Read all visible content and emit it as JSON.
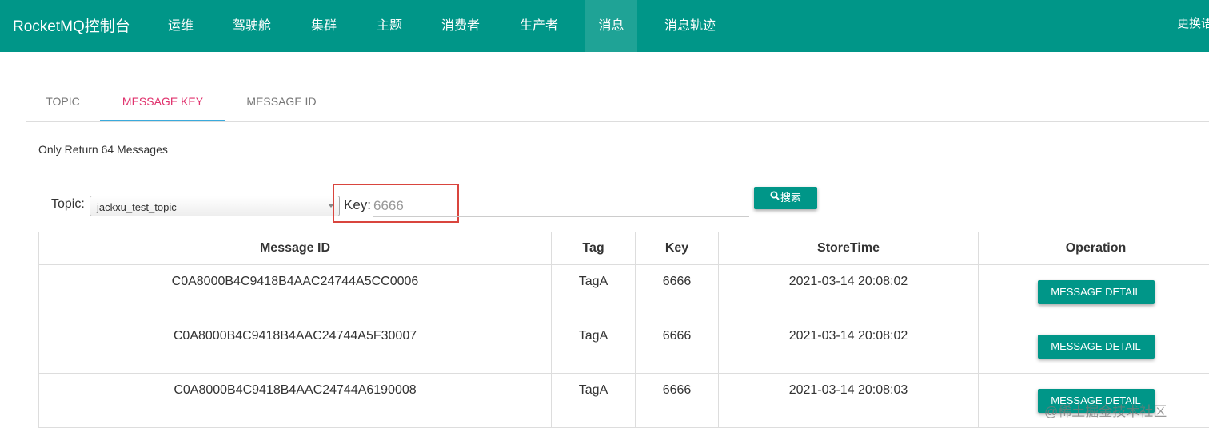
{
  "brand": "RocketMQ控制台",
  "nav": {
    "items": [
      {
        "label": "运维"
      },
      {
        "label": "驾驶舱"
      },
      {
        "label": "集群"
      },
      {
        "label": "主题"
      },
      {
        "label": "消费者"
      },
      {
        "label": "生产者"
      },
      {
        "label": "消息"
      },
      {
        "label": "消息轨迹"
      }
    ],
    "active": "消息",
    "right_label": "更换语"
  },
  "tabs": [
    {
      "label": "TOPIC"
    },
    {
      "label": "MESSAGE KEY"
    },
    {
      "label": "MESSAGE ID"
    }
  ],
  "active_tab": "MESSAGE KEY",
  "info_text": "Only Return 64 Messages",
  "search": {
    "topic_label": "Topic:",
    "topic_value": "jackxu_test_topic",
    "key_label": "Key:",
    "key_value": "6666",
    "button_label": "搜索",
    "button_icon": "search-icon"
  },
  "table": {
    "headers": [
      "Message ID",
      "Tag",
      "Key",
      "StoreTime",
      "Operation"
    ],
    "rows": [
      {
        "message_id": "C0A8000B4C9418B4AAC24744A5CC0006",
        "tag": "TagA",
        "key": "6666",
        "store_time": "2021-03-14 20:08:02",
        "action": "MESSAGE DETAIL"
      },
      {
        "message_id": "C0A8000B4C9418B4AAC24744A5F30007",
        "tag": "TagA",
        "key": "6666",
        "store_time": "2021-03-14 20:08:02",
        "action": "MESSAGE DETAIL"
      },
      {
        "message_id": "C0A8000B4C9418B4AAC24744A6190008",
        "tag": "TagA",
        "key": "6666",
        "store_time": "2021-03-14 20:08:03",
        "action": "MESSAGE DETAIL"
      }
    ]
  },
  "watermark": "@稀土掘金技术社区",
  "colors": {
    "primary": "#009688",
    "active_tab_text": "#e0326d",
    "active_tab_underline": "#3aaadc",
    "highlight_box": "#d9453e"
  }
}
